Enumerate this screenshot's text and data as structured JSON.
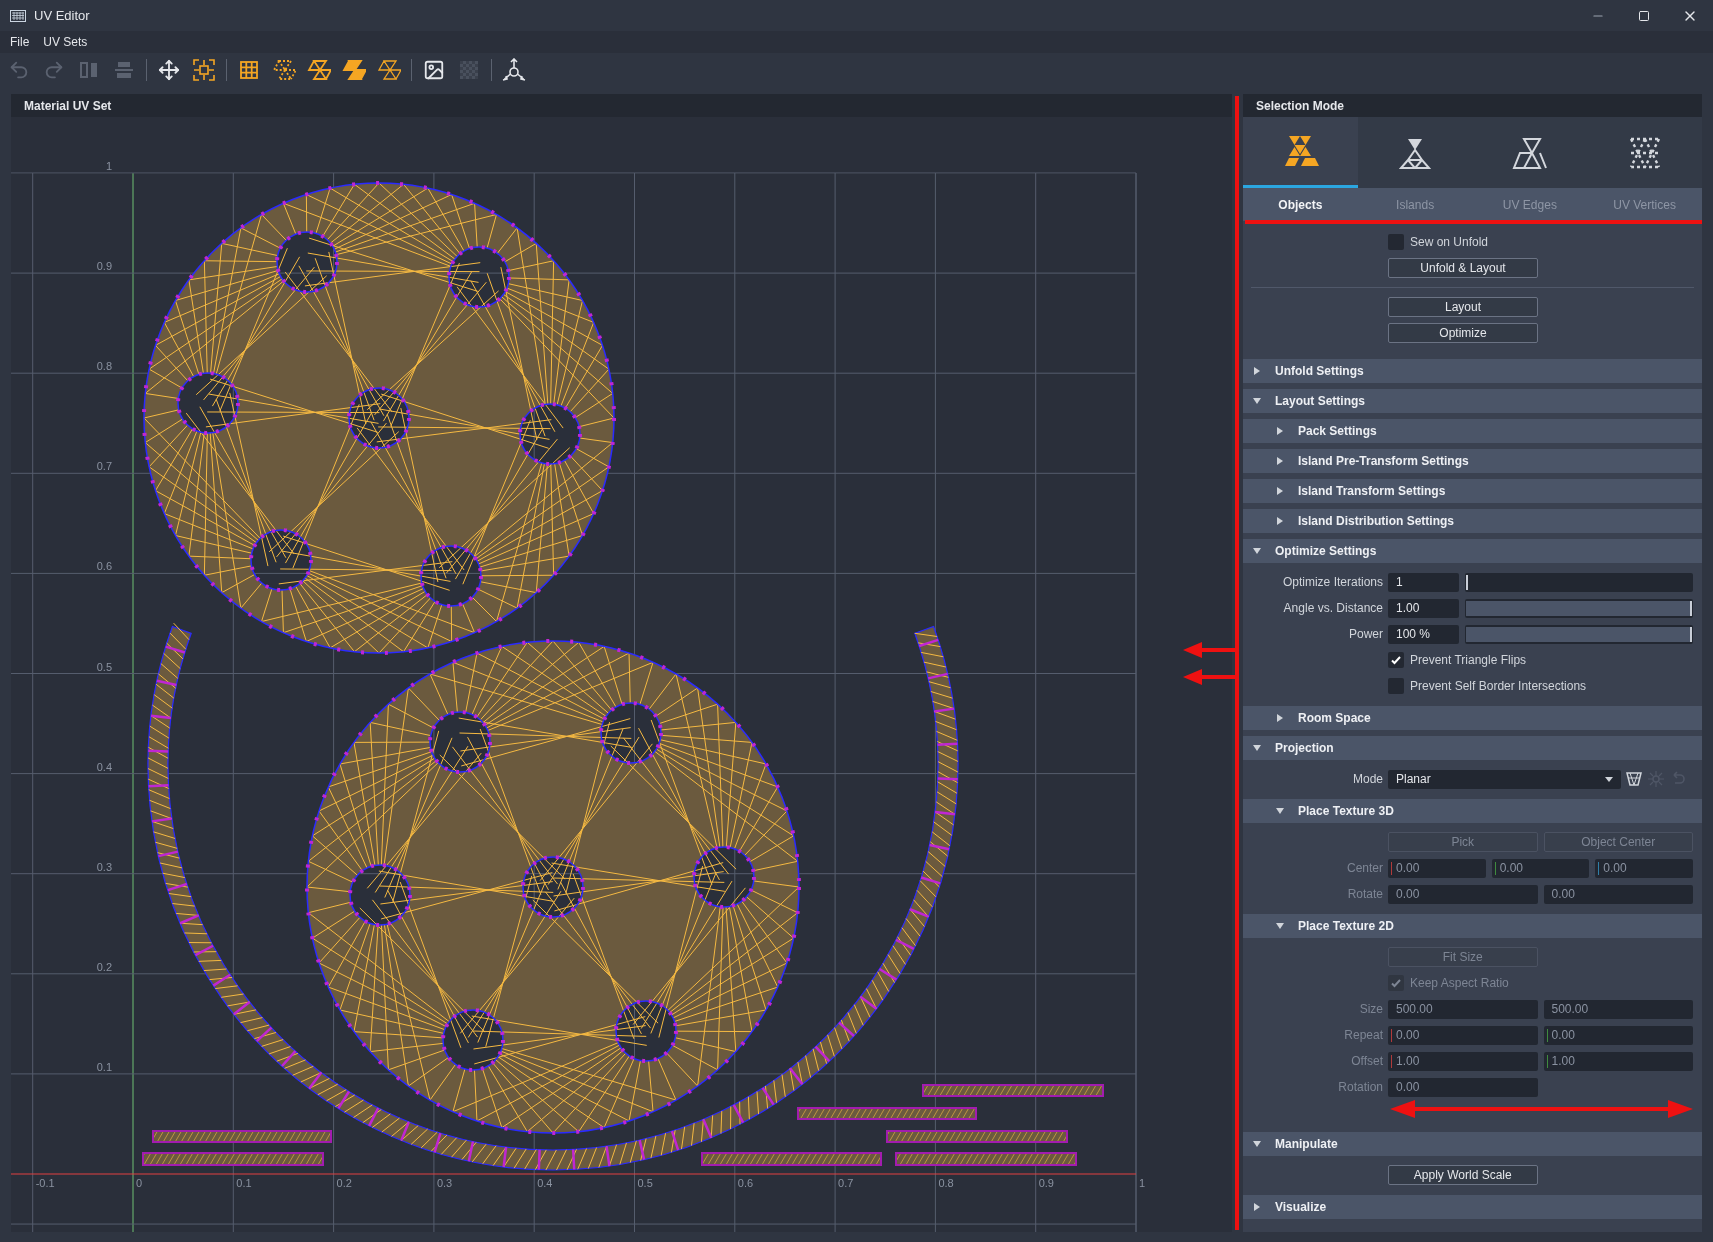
{
  "window": {
    "title": "UV Editor"
  },
  "menu": [
    "File",
    "UV Sets"
  ],
  "toolbar": [
    {
      "kind": "undo",
      "disabled": true
    },
    {
      "kind": "redo",
      "disabled": true
    },
    {
      "kind": "mirror",
      "disabled": true
    },
    {
      "kind": "align",
      "disabled": true
    },
    {
      "kind": "separator"
    },
    {
      "kind": "move",
      "disabled": false,
      "on": false
    },
    {
      "kind": "transform",
      "disabled": false,
      "on": true
    },
    {
      "kind": "separator"
    },
    {
      "kind": "grid",
      "disabled": false,
      "on": true
    },
    {
      "kind": "mesh_vertices",
      "disabled": false,
      "on": true
    },
    {
      "kind": "mesh_edges",
      "disabled": false,
      "on": true
    },
    {
      "kind": "mesh_faces",
      "disabled": false,
      "on": true
    },
    {
      "kind": "mesh_islands",
      "disabled": false,
      "on": true
    },
    {
      "kind": "separator"
    },
    {
      "kind": "image",
      "disabled": false,
      "on": false
    },
    {
      "kind": "checker",
      "disabled": true
    },
    {
      "kind": "separator"
    },
    {
      "kind": "gizmo",
      "disabled": false,
      "on": false
    }
  ],
  "uv_panel": {
    "title": "Material UV Set",
    "u_labels": [
      "-0.1",
      "0",
      "0.1",
      "0.2",
      "0.3",
      "0.4",
      "0.5",
      "0.6",
      "0.7",
      "0.8",
      "0.9",
      "1"
    ],
    "v_labels": [
      "1",
      "0.9",
      "0.8",
      "0.7",
      "0.6",
      "0.5",
      "0.4",
      "0.3",
      "0.2",
      "0.1"
    ]
  },
  "selection_mode": {
    "title": "Selection Mode",
    "modes": [
      {
        "kind": "objects",
        "label": "Objects",
        "selected": true
      },
      {
        "kind": "islands",
        "label": "Islands",
        "selected": false
      },
      {
        "kind": "edges",
        "label": "UV Edges",
        "selected": false
      },
      {
        "kind": "vertices",
        "label": "UV Vertices",
        "selected": false
      }
    ]
  },
  "actions": {
    "sew_on_unfold": {
      "label": "Sew on Unfold",
      "checked": false
    },
    "unfold_layout": "Unfold & Layout",
    "layout": "Layout",
    "optimize": "Optimize"
  },
  "sections": [
    {
      "title": "Unfold Settings",
      "expanded": false
    },
    {
      "title": "Layout Settings",
      "expanded": true,
      "children": [
        {
          "title": "Pack Settings",
          "expanded": false
        },
        {
          "title": "Island Pre-Transform Settings",
          "expanded": false
        },
        {
          "title": "Island Transform Settings",
          "expanded": false
        },
        {
          "title": "Island Distribution Settings",
          "expanded": false
        }
      ]
    },
    {
      "title": "Optimize Settings",
      "expanded": true,
      "rows": [
        {
          "kind": "slider",
          "label": "Optimize Iterations",
          "value": "1",
          "level": 0
        },
        {
          "kind": "slider",
          "label": "Angle vs. Distance",
          "value": "1.00",
          "level": 1
        },
        {
          "kind": "slider",
          "label": "Power",
          "value": "100 %",
          "level": 1
        },
        {
          "kind": "checkbox",
          "label": "Prevent Triangle Flips",
          "checked": true,
          "disabled": false
        },
        {
          "kind": "checkbox",
          "label": "Prevent Self Border Intersections",
          "checked": false,
          "disabled": false
        }
      ],
      "children": [
        {
          "title": "Room Space",
          "expanded": false
        }
      ]
    },
    {
      "title": "Projection",
      "expanded": true,
      "rows": [
        {
          "kind": "dropdown",
          "label": "Mode",
          "value": "Planar",
          "tools": [
            {
              "disabled": false
            },
            {
              "disabled": true
            },
            {
              "disabled": true
            }
          ]
        }
      ],
      "children": [
        {
          "title": "Place Texture 3D",
          "expanded": true,
          "rows": [
            {
              "kind": "buttons",
              "buttons": [
                {
                  "label": "Pick",
                  "disabled": true
                },
                {
                  "label": "Object Center",
                  "disabled": true
                }
              ]
            },
            {
              "kind": "fields",
              "label": "Center",
              "disabled": true,
              "fields": [
                {
                  "value": "0.00",
                  "color": "#b03a3a"
                },
                {
                  "value": "0.00",
                  "color": "#3f8a3f"
                },
                {
                  "value": "0.00",
                  "color": "#2f7fa8"
                }
              ]
            },
            {
              "kind": "fields",
              "label": "Rotate",
              "disabled": true,
              "fields": [
                {
                  "value": "0.00"
                },
                {
                  "value": "0.00"
                }
              ]
            }
          ]
        },
        {
          "title": "Place Texture 2D",
          "expanded": true,
          "rows": [
            {
              "kind": "buttons",
              "buttons": [
                {
                  "label": "Fit Size",
                  "disabled": true
                }
              ]
            },
            {
              "kind": "checkbox",
              "label": "Keep Aspect Ratio",
              "checked": true,
              "disabled": true
            },
            {
              "kind": "fields",
              "label": "Size",
              "disabled": true,
              "fields": [
                {
                  "value": "500.00"
                },
                {
                  "value": "500.00"
                }
              ]
            },
            {
              "kind": "fields",
              "label": "Repeat",
              "disabled": true,
              "fields": [
                {
                  "value": "0.00",
                  "color": "#b03a3a"
                },
                {
                  "value": "0.00",
                  "color": "#3f8a3f"
                }
              ]
            },
            {
              "kind": "fields",
              "label": "Offset",
              "disabled": true,
              "fields": [
                {
                  "value": "1.00",
                  "color": "#b03a3a"
                },
                {
                  "value": "1.00",
                  "color": "#3f8a3f"
                }
              ]
            },
            {
              "kind": "fields",
              "label": "Rotation",
              "disabled": true,
              "fields": [
                {
                  "value": "0.00"
                }
              ]
            }
          ]
        }
      ]
    },
    {
      "title": "Manipulate",
      "expanded": true,
      "rows": [
        {
          "kind": "buttons",
          "buttons": [
            {
              "label": "Apply World Scale",
              "disabled": false
            }
          ]
        }
      ]
    },
    {
      "title": "Visualize",
      "expanded": false
    }
  ]
}
